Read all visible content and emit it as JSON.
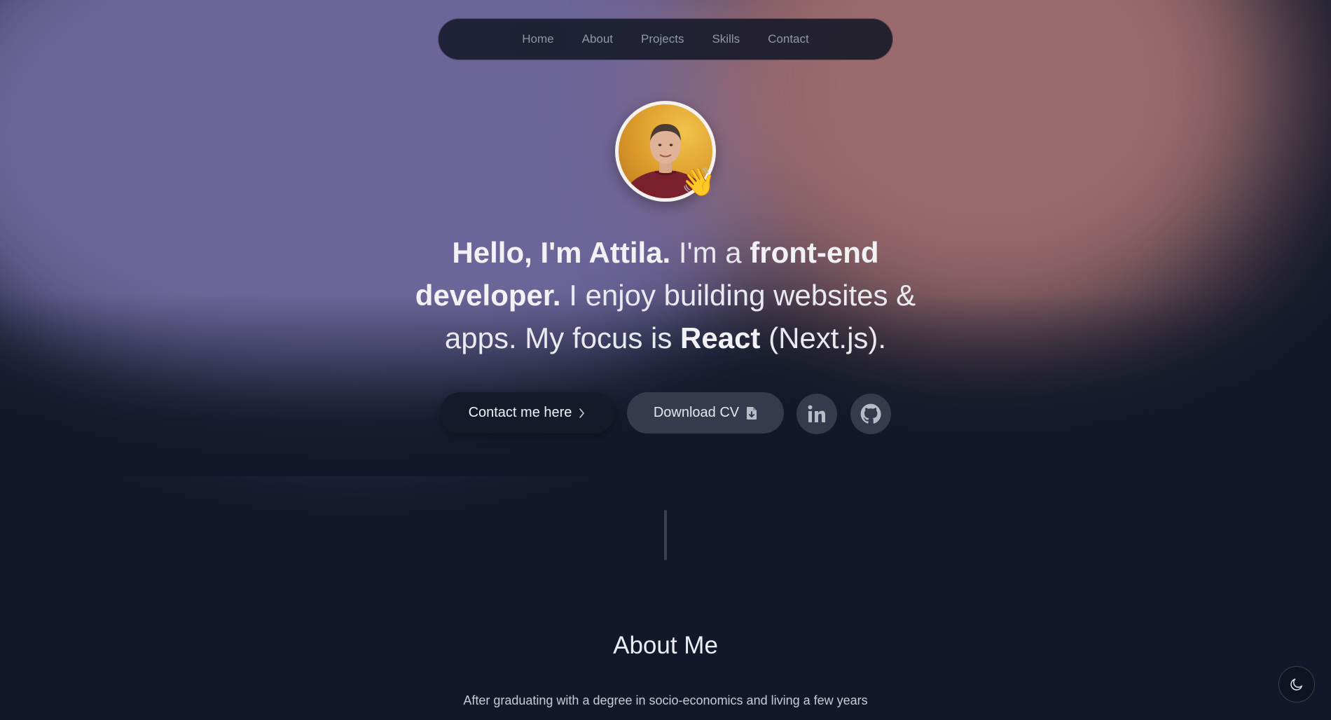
{
  "nav": {
    "items": [
      {
        "label": "Home",
        "active": true
      },
      {
        "label": "About"
      },
      {
        "label": "Projects"
      },
      {
        "label": "Skills"
      },
      {
        "label": "Contact"
      }
    ]
  },
  "hero": {
    "avatar_icon": "waving-hand-icon",
    "avatar_emoji": "👋",
    "headline": {
      "part1_bold": "Hello, I'm Attila.",
      "part2": " I'm a ",
      "part3_bold": "front-end developer.",
      "part4": " I enjoy building websites & apps. My focus is ",
      "part5_bold": "React",
      "part6": " (Next.js)."
    },
    "buttons": {
      "contact_label": "Contact me here",
      "contact_icon": "chevron-right-icon",
      "cv_label": "Download CV",
      "cv_icon": "file-download-icon",
      "linkedin_icon": "linkedin-icon",
      "github_icon": "github-icon"
    }
  },
  "about": {
    "title": "About Me",
    "text": "After graduating with a degree in socio-economics and living a few years"
  },
  "theme_toggle": {
    "icon": "moon-icon"
  },
  "colors": {
    "background": "#121829",
    "blob_left": "#6c6599",
    "blob_right": "#9a6a6e",
    "button_dark": "#141a2a",
    "button_muted": "#353b4c"
  }
}
